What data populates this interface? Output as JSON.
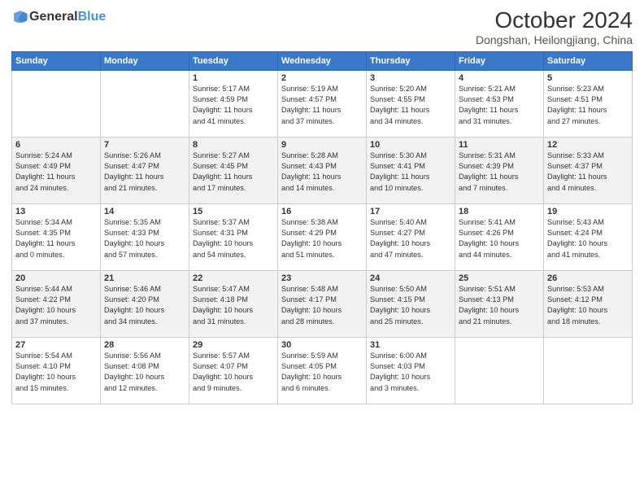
{
  "header": {
    "logo_general": "General",
    "logo_blue": "Blue",
    "title": "October 2024",
    "location": "Dongshan, Heilongjiang, China"
  },
  "weekdays": [
    "Sunday",
    "Monday",
    "Tuesday",
    "Wednesday",
    "Thursday",
    "Friday",
    "Saturday"
  ],
  "weeks": [
    [
      {
        "day": "",
        "info": ""
      },
      {
        "day": "",
        "info": ""
      },
      {
        "day": "1",
        "info": "Sunrise: 5:17 AM\nSunset: 4:59 PM\nDaylight: 11 hours\nand 41 minutes."
      },
      {
        "day": "2",
        "info": "Sunrise: 5:19 AM\nSunset: 4:57 PM\nDaylight: 11 hours\nand 37 minutes."
      },
      {
        "day": "3",
        "info": "Sunrise: 5:20 AM\nSunset: 4:55 PM\nDaylight: 11 hours\nand 34 minutes."
      },
      {
        "day": "4",
        "info": "Sunrise: 5:21 AM\nSunset: 4:53 PM\nDaylight: 11 hours\nand 31 minutes."
      },
      {
        "day": "5",
        "info": "Sunrise: 5:23 AM\nSunset: 4:51 PM\nDaylight: 11 hours\nand 27 minutes."
      }
    ],
    [
      {
        "day": "6",
        "info": "Sunrise: 5:24 AM\nSunset: 4:49 PM\nDaylight: 11 hours\nand 24 minutes."
      },
      {
        "day": "7",
        "info": "Sunrise: 5:26 AM\nSunset: 4:47 PM\nDaylight: 11 hours\nand 21 minutes."
      },
      {
        "day": "8",
        "info": "Sunrise: 5:27 AM\nSunset: 4:45 PM\nDaylight: 11 hours\nand 17 minutes."
      },
      {
        "day": "9",
        "info": "Sunrise: 5:28 AM\nSunset: 4:43 PM\nDaylight: 11 hours\nand 14 minutes."
      },
      {
        "day": "10",
        "info": "Sunrise: 5:30 AM\nSunset: 4:41 PM\nDaylight: 11 hours\nand 10 minutes."
      },
      {
        "day": "11",
        "info": "Sunrise: 5:31 AM\nSunset: 4:39 PM\nDaylight: 11 hours\nand 7 minutes."
      },
      {
        "day": "12",
        "info": "Sunrise: 5:33 AM\nSunset: 4:37 PM\nDaylight: 11 hours\nand 4 minutes."
      }
    ],
    [
      {
        "day": "13",
        "info": "Sunrise: 5:34 AM\nSunset: 4:35 PM\nDaylight: 11 hours\nand 0 minutes."
      },
      {
        "day": "14",
        "info": "Sunrise: 5:35 AM\nSunset: 4:33 PM\nDaylight: 10 hours\nand 57 minutes."
      },
      {
        "day": "15",
        "info": "Sunrise: 5:37 AM\nSunset: 4:31 PM\nDaylight: 10 hours\nand 54 minutes."
      },
      {
        "day": "16",
        "info": "Sunrise: 5:38 AM\nSunset: 4:29 PM\nDaylight: 10 hours\nand 51 minutes."
      },
      {
        "day": "17",
        "info": "Sunrise: 5:40 AM\nSunset: 4:27 PM\nDaylight: 10 hours\nand 47 minutes."
      },
      {
        "day": "18",
        "info": "Sunrise: 5:41 AM\nSunset: 4:26 PM\nDaylight: 10 hours\nand 44 minutes."
      },
      {
        "day": "19",
        "info": "Sunrise: 5:43 AM\nSunset: 4:24 PM\nDaylight: 10 hours\nand 41 minutes."
      }
    ],
    [
      {
        "day": "20",
        "info": "Sunrise: 5:44 AM\nSunset: 4:22 PM\nDaylight: 10 hours\nand 37 minutes."
      },
      {
        "day": "21",
        "info": "Sunrise: 5:46 AM\nSunset: 4:20 PM\nDaylight: 10 hours\nand 34 minutes."
      },
      {
        "day": "22",
        "info": "Sunrise: 5:47 AM\nSunset: 4:18 PM\nDaylight: 10 hours\nand 31 minutes."
      },
      {
        "day": "23",
        "info": "Sunrise: 5:48 AM\nSunset: 4:17 PM\nDaylight: 10 hours\nand 28 minutes."
      },
      {
        "day": "24",
        "info": "Sunrise: 5:50 AM\nSunset: 4:15 PM\nDaylight: 10 hours\nand 25 minutes."
      },
      {
        "day": "25",
        "info": "Sunrise: 5:51 AM\nSunset: 4:13 PM\nDaylight: 10 hours\nand 21 minutes."
      },
      {
        "day": "26",
        "info": "Sunrise: 5:53 AM\nSunset: 4:12 PM\nDaylight: 10 hours\nand 18 minutes."
      }
    ],
    [
      {
        "day": "27",
        "info": "Sunrise: 5:54 AM\nSunset: 4:10 PM\nDaylight: 10 hours\nand 15 minutes."
      },
      {
        "day": "28",
        "info": "Sunrise: 5:56 AM\nSunset: 4:08 PM\nDaylight: 10 hours\nand 12 minutes."
      },
      {
        "day": "29",
        "info": "Sunrise: 5:57 AM\nSunset: 4:07 PM\nDaylight: 10 hours\nand 9 minutes."
      },
      {
        "day": "30",
        "info": "Sunrise: 5:59 AM\nSunset: 4:05 PM\nDaylight: 10 hours\nand 6 minutes."
      },
      {
        "day": "31",
        "info": "Sunrise: 6:00 AM\nSunset: 4:03 PM\nDaylight: 10 hours\nand 3 minutes."
      },
      {
        "day": "",
        "info": ""
      },
      {
        "day": "",
        "info": ""
      }
    ]
  ]
}
